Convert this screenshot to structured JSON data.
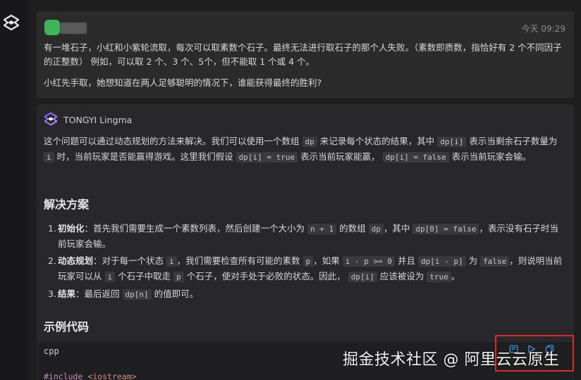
{
  "user_message": {
    "timestamp": "今天 09:29",
    "paragraph1": "有一堆石子，小红和小紫轮流取，每次可以取素数个石子。最终无法进行取石子的那个人失败。（素数即质数，指恰好有 2 个不同因子的正整数） 例如，可以取 2 个、3 个、5个，但不能取 1 个或 4 个。",
    "paragraph2": "小红先手取，她想知道在两人足够聪明的情况下，谁能获得最终的胜利?"
  },
  "ai_message": {
    "name": "TONGYI Lingma",
    "intro": {
      "t1": "这个问题可以通过动态规划的方法来解决。我们可以使用一个数组",
      "c1": "dp",
      "t2": "来记录每个状态的结果，其中",
      "c2": "dp[i]",
      "t3": "表示当剩余石子数量为",
      "c3": "i",
      "t4": "时，当前玩家是否能赢得游戏。这里我们假设",
      "c4": "dp[i] = true",
      "t5": "表示当前玩家能赢，",
      "c5": "dp[i] = false",
      "t6": "表示当前玩家会输。"
    },
    "solution_heading": "解决方案",
    "steps": [
      {
        "num": "1.",
        "label": "初始化",
        "t1": "：首先我们需要生成一个素数列表，然后创建一个大小为",
        "c1": "n + 1",
        "t2": "的数组",
        "c2": "dp",
        "t3": "，其中",
        "c3": "dp[0] = false",
        "t4": "，表示没有石子时当前玩家会输。"
      },
      {
        "num": "2.",
        "label": "动态规划",
        "t1": "：对于每一个状态",
        "c1": "i",
        "t2": "，我们需要检查所有可能的素数",
        "c2": "p",
        "t3": "，如果",
        "c3": "i - p >= 0",
        "t4": "并且",
        "c4": "dp[i - p]",
        "t5": "为",
        "c5": "false",
        "t6": "，则说明当前玩家可以从",
        "c6": "i",
        "t7": "个石子中取走",
        "c7": "p",
        "t8": "个石子，使对手处于必败的状态。因此，",
        "c8": "dp[i]",
        "t9": "应该被设为",
        "c9": "true",
        "t10": "。"
      },
      {
        "num": "3.",
        "label": "结果",
        "t1": "：最后返回",
        "c1": "dp[n]",
        "t2": "的值即可。"
      }
    ],
    "code_heading": "示例代码",
    "code": {
      "language": "cpp",
      "line1_kw": "#include",
      "line1_str": "<iostream>"
    }
  },
  "watermark": "掘金技术社区 @ 阿里云云原生",
  "colors": {
    "accent_highlight": "#e02a2a",
    "avatar": "#3fb45b",
    "toolbar_icon": "#3c8ee0"
  },
  "icons": [
    "app-logo-icon",
    "tongyi-logo-icon",
    "insert-code-icon",
    "run-icon",
    "copy-icon"
  ]
}
